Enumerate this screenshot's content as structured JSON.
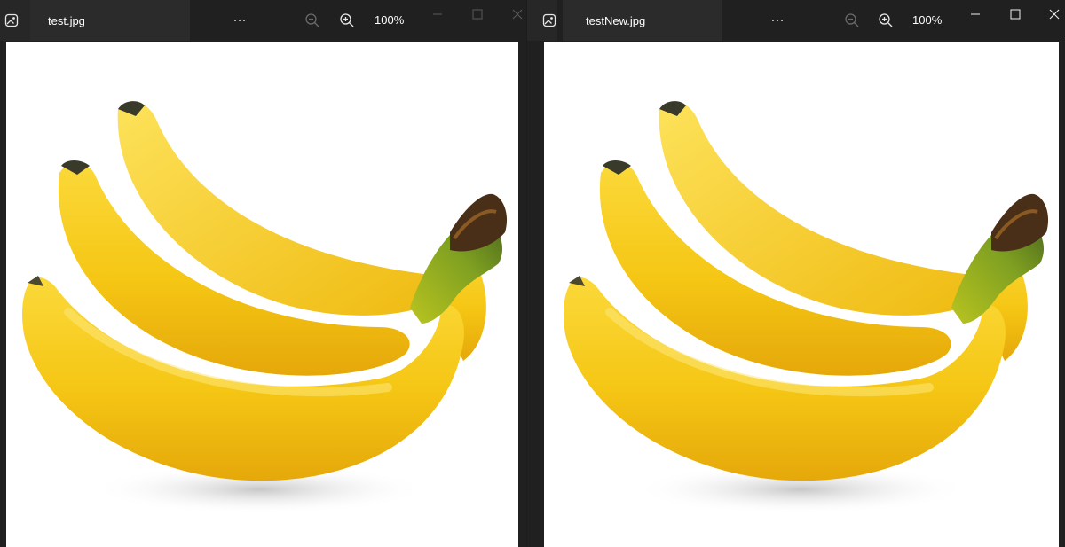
{
  "windows": [
    {
      "file_name": "test.jpg",
      "zoom_level": "100%",
      "icons": [
        "photos-app-icon",
        "more-options-icon",
        "zoom-out-icon",
        "zoom-in-icon",
        "minimize-icon",
        "maximize-icon",
        "close-icon"
      ],
      "photo_subject": "bananas-image"
    },
    {
      "file_name": "testNew.jpg",
      "zoom_level": "100%",
      "icons": [
        "photos-app-icon",
        "more-options-icon",
        "zoom-out-icon",
        "zoom-in-icon",
        "minimize-icon",
        "maximize-icon",
        "close-icon"
      ],
      "photo_subject": "bananas-image"
    }
  ],
  "colors": {
    "title_bar": "#202020",
    "tab_active": "#2b2b2b",
    "canvas": "#ffffff",
    "banana_yellow": "#f6cc1d"
  }
}
